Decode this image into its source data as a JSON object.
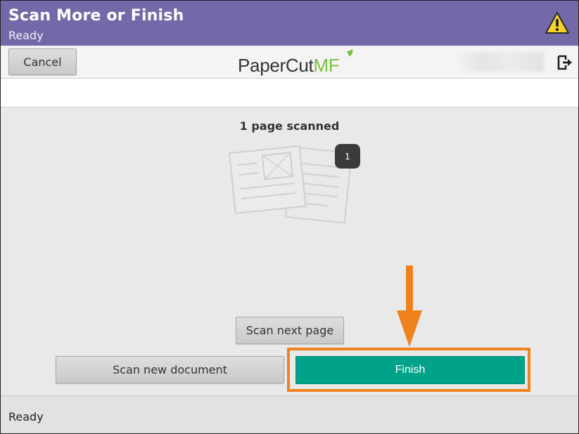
{
  "header": {
    "title": "Scan More or Finish",
    "subtitle": "Ready",
    "warning_icon": "warning-triangle-icon"
  },
  "toolbar": {
    "cancel_label": "Cancel",
    "logo": {
      "text": "PaperCut",
      "accent": "MF"
    },
    "logout_icon": "logout-icon"
  },
  "main": {
    "scanned_text": "1 page scanned",
    "page_count": "1",
    "scan_next_label": "Scan next page",
    "scan_new_label": "Scan new document",
    "finish_label": "Finish"
  },
  "status": {
    "text": "Ready"
  },
  "colors": {
    "header": "#7469a8",
    "finish": "#00a38a",
    "highlight": "#f0821e",
    "logo_accent": "#7bc043"
  }
}
